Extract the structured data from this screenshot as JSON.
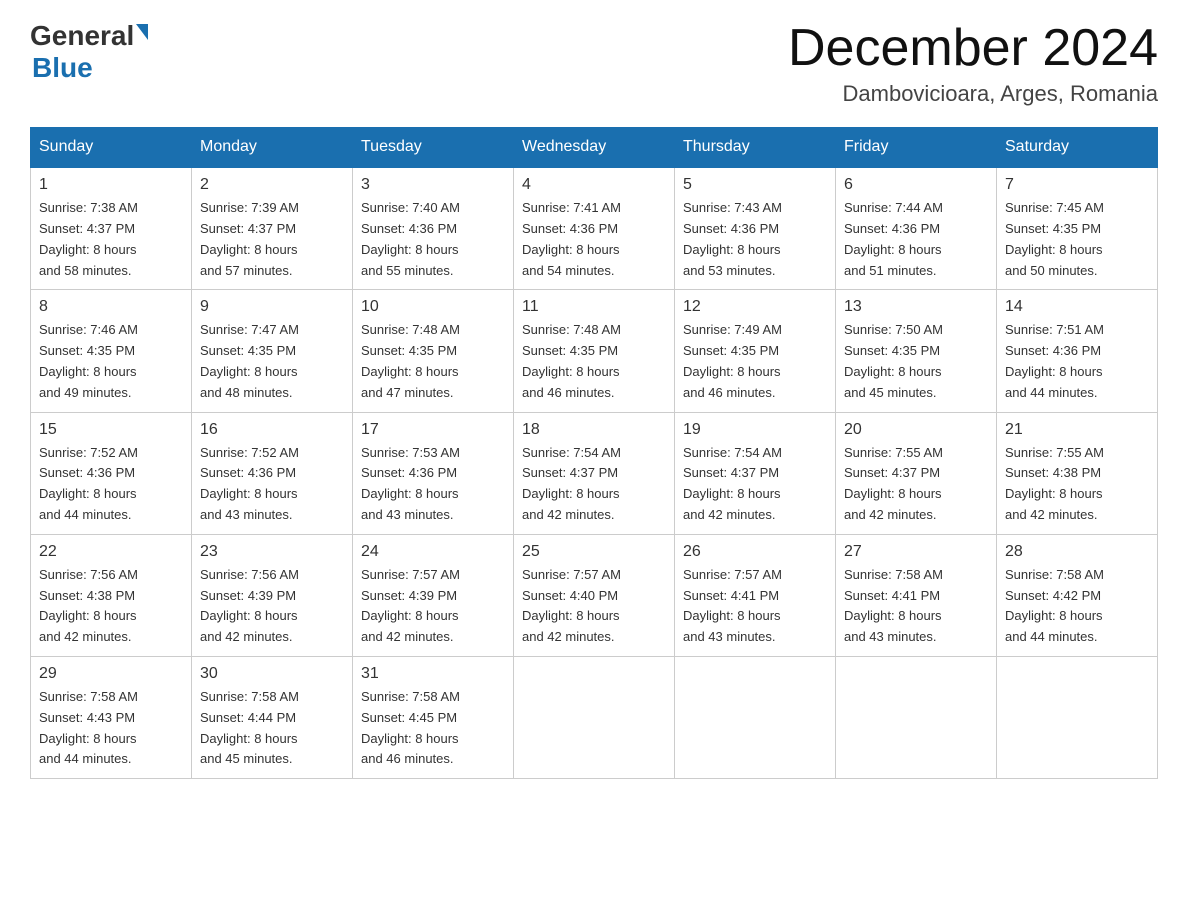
{
  "header": {
    "logo_general": "General",
    "logo_blue": "Blue",
    "month_title": "December 2024",
    "location": "Dambovicioara, Arges, Romania"
  },
  "days_of_week": [
    "Sunday",
    "Monday",
    "Tuesday",
    "Wednesday",
    "Thursday",
    "Friday",
    "Saturday"
  ],
  "weeks": [
    [
      {
        "day": "1",
        "sunrise": "7:38 AM",
        "sunset": "4:37 PM",
        "daylight": "8 hours and 58 minutes."
      },
      {
        "day": "2",
        "sunrise": "7:39 AM",
        "sunset": "4:37 PM",
        "daylight": "8 hours and 57 minutes."
      },
      {
        "day": "3",
        "sunrise": "7:40 AM",
        "sunset": "4:36 PM",
        "daylight": "8 hours and 55 minutes."
      },
      {
        "day": "4",
        "sunrise": "7:41 AM",
        "sunset": "4:36 PM",
        "daylight": "8 hours and 54 minutes."
      },
      {
        "day": "5",
        "sunrise": "7:43 AM",
        "sunset": "4:36 PM",
        "daylight": "8 hours and 53 minutes."
      },
      {
        "day": "6",
        "sunrise": "7:44 AM",
        "sunset": "4:36 PM",
        "daylight": "8 hours and 51 minutes."
      },
      {
        "day": "7",
        "sunrise": "7:45 AM",
        "sunset": "4:35 PM",
        "daylight": "8 hours and 50 minutes."
      }
    ],
    [
      {
        "day": "8",
        "sunrise": "7:46 AM",
        "sunset": "4:35 PM",
        "daylight": "8 hours and 49 minutes."
      },
      {
        "day": "9",
        "sunrise": "7:47 AM",
        "sunset": "4:35 PM",
        "daylight": "8 hours and 48 minutes."
      },
      {
        "day": "10",
        "sunrise": "7:48 AM",
        "sunset": "4:35 PM",
        "daylight": "8 hours and 47 minutes."
      },
      {
        "day": "11",
        "sunrise": "7:48 AM",
        "sunset": "4:35 PM",
        "daylight": "8 hours and 46 minutes."
      },
      {
        "day": "12",
        "sunrise": "7:49 AM",
        "sunset": "4:35 PM",
        "daylight": "8 hours and 46 minutes."
      },
      {
        "day": "13",
        "sunrise": "7:50 AM",
        "sunset": "4:35 PM",
        "daylight": "8 hours and 45 minutes."
      },
      {
        "day": "14",
        "sunrise": "7:51 AM",
        "sunset": "4:36 PM",
        "daylight": "8 hours and 44 minutes."
      }
    ],
    [
      {
        "day": "15",
        "sunrise": "7:52 AM",
        "sunset": "4:36 PM",
        "daylight": "8 hours and 44 minutes."
      },
      {
        "day": "16",
        "sunrise": "7:52 AM",
        "sunset": "4:36 PM",
        "daylight": "8 hours and 43 minutes."
      },
      {
        "day": "17",
        "sunrise": "7:53 AM",
        "sunset": "4:36 PM",
        "daylight": "8 hours and 43 minutes."
      },
      {
        "day": "18",
        "sunrise": "7:54 AM",
        "sunset": "4:37 PM",
        "daylight": "8 hours and 42 minutes."
      },
      {
        "day": "19",
        "sunrise": "7:54 AM",
        "sunset": "4:37 PM",
        "daylight": "8 hours and 42 minutes."
      },
      {
        "day": "20",
        "sunrise": "7:55 AM",
        "sunset": "4:37 PM",
        "daylight": "8 hours and 42 minutes."
      },
      {
        "day": "21",
        "sunrise": "7:55 AM",
        "sunset": "4:38 PM",
        "daylight": "8 hours and 42 minutes."
      }
    ],
    [
      {
        "day": "22",
        "sunrise": "7:56 AM",
        "sunset": "4:38 PM",
        "daylight": "8 hours and 42 minutes."
      },
      {
        "day": "23",
        "sunrise": "7:56 AM",
        "sunset": "4:39 PM",
        "daylight": "8 hours and 42 minutes."
      },
      {
        "day": "24",
        "sunrise": "7:57 AM",
        "sunset": "4:39 PM",
        "daylight": "8 hours and 42 minutes."
      },
      {
        "day": "25",
        "sunrise": "7:57 AM",
        "sunset": "4:40 PM",
        "daylight": "8 hours and 42 minutes."
      },
      {
        "day": "26",
        "sunrise": "7:57 AM",
        "sunset": "4:41 PM",
        "daylight": "8 hours and 43 minutes."
      },
      {
        "day": "27",
        "sunrise": "7:58 AM",
        "sunset": "4:41 PM",
        "daylight": "8 hours and 43 minutes."
      },
      {
        "day": "28",
        "sunrise": "7:58 AM",
        "sunset": "4:42 PM",
        "daylight": "8 hours and 44 minutes."
      }
    ],
    [
      {
        "day": "29",
        "sunrise": "7:58 AM",
        "sunset": "4:43 PM",
        "daylight": "8 hours and 44 minutes."
      },
      {
        "day": "30",
        "sunrise": "7:58 AM",
        "sunset": "4:44 PM",
        "daylight": "8 hours and 45 minutes."
      },
      {
        "day": "31",
        "sunrise": "7:58 AM",
        "sunset": "4:45 PM",
        "daylight": "8 hours and 46 minutes."
      },
      null,
      null,
      null,
      null
    ]
  ],
  "labels": {
    "sunrise": "Sunrise:",
    "sunset": "Sunset:",
    "daylight": "Daylight:"
  }
}
